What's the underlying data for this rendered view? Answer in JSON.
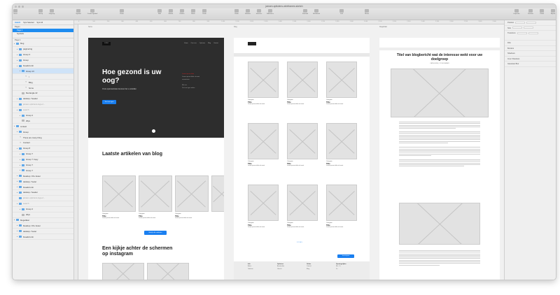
{
  "window": {
    "title": "jansen-opticiens-wireframes.sketch",
    "document_tab": "jansen-opticiens-wireframes.sketch"
  },
  "toolbar": {
    "items": [
      "Insert",
      "Group",
      "Ungroup",
      "Symbol",
      "Create Symbol",
      "Zoom",
      "Edit",
      "Rotate",
      "Flatten",
      "Mask",
      "Scale",
      "Union",
      "Subtract",
      "Intersect",
      "Difference",
      "Forward",
      "Backward",
      "Link",
      "Share",
      "Inspector",
      "Preview",
      "Cloud",
      "Export"
    ]
  },
  "sidebar": {
    "top_tabs": [
      "Sync Selected",
      "Sync All"
    ],
    "pages_heading": "Pages",
    "pages": [
      "Page 1",
      "Symbols"
    ],
    "layers_heading": "Page 1",
    "layers": [
      "blog",
      "paginering",
      "Group 3",
      "Group",
      "breadcrumb",
      "Group 13",
      "/",
      "Blog",
      "home",
      "Rectangle 22",
      "desktop / header",
      "jansen-opticiens-logo-2...",
      "search",
      "Group 2",
      "20px",
      "contact",
      "Group",
      "There are many thing",
      "Contact",
      "Group 8",
      "Group 7",
      "Group 7 Copy",
      "Group 7",
      "Group 7",
      "Desktop / Pre footer",
      "desktop / footer",
      "breadcrumb",
      "desktop / header",
      "jansen-opticiens-logo-2...",
      "search",
      "Group 2",
      "20px",
      "blogartikel",
      "Desktop / Pre footer",
      "desktop / footer",
      "breadcrumb"
    ]
  },
  "inspector": {
    "rows": [
      "Position",
      "Size",
      "Transform",
      "Fills",
      "Borders",
      "Shadows",
      "Inner Shadows",
      "Gaussian Blur"
    ]
  },
  "ruler": [
    "0",
    "100",
    "200",
    "300",
    "400",
    "500",
    "600",
    "700",
    "800",
    "900",
    "1.000",
    "1.100",
    "1.200",
    "1.300",
    "1.400",
    "1.500",
    "1.600",
    "1.700",
    "1.800",
    "1.900",
    "2.000",
    "2.100",
    "2.200",
    "2.300",
    "2.400",
    "2.500",
    "2.600",
    "2.700",
    "2.800",
    "2.900"
  ],
  "artboard1": {
    "label": "home",
    "hero_title": "Hoe gezond is uw oog?",
    "hero_sub": "Onze optometristen kunnen het u vertellen",
    "hero_button": "Test uw ogen",
    "section1": "Laatste artikelen van blog",
    "card_title": "Title",
    "card_cat": "Categorie",
    "all_button": "Bekijk alle artikelen",
    "section2": "Een kijkje achter de schermen op instagram"
  },
  "artboard2": {
    "label": "blog",
    "card_title": "Title",
    "card_cat": "Categorie",
    "subscribe_button": "Inschrijven",
    "footer_cols": [
      "Info",
      "Opticiens",
      "Online",
      "Openingstijden"
    ]
  },
  "artboard3": {
    "label": "blogartikel",
    "title": "Titel van blogbericht wat de interesse wekt voor uw doelgroep",
    "meta": "CATEGORIE | 12 DECEMBER"
  }
}
